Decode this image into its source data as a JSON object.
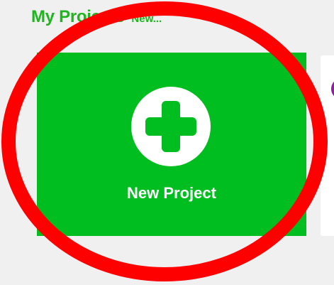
{
  "header": {
    "title": "My Projects",
    "link_label": "New..."
  },
  "new_project_card": {
    "label": "New Project",
    "icon": "plus-circle-icon",
    "background_color": "#00be1f",
    "icon_color": "#ffffff"
  },
  "next_project_card": {
    "avatar_color": "#8f1fa0"
  },
  "annotation": {
    "shape": "ellipse",
    "stroke_color": "#ff0000"
  },
  "colors": {
    "accent_green": "#1fb51f",
    "page_background": "#f0f0f0"
  }
}
